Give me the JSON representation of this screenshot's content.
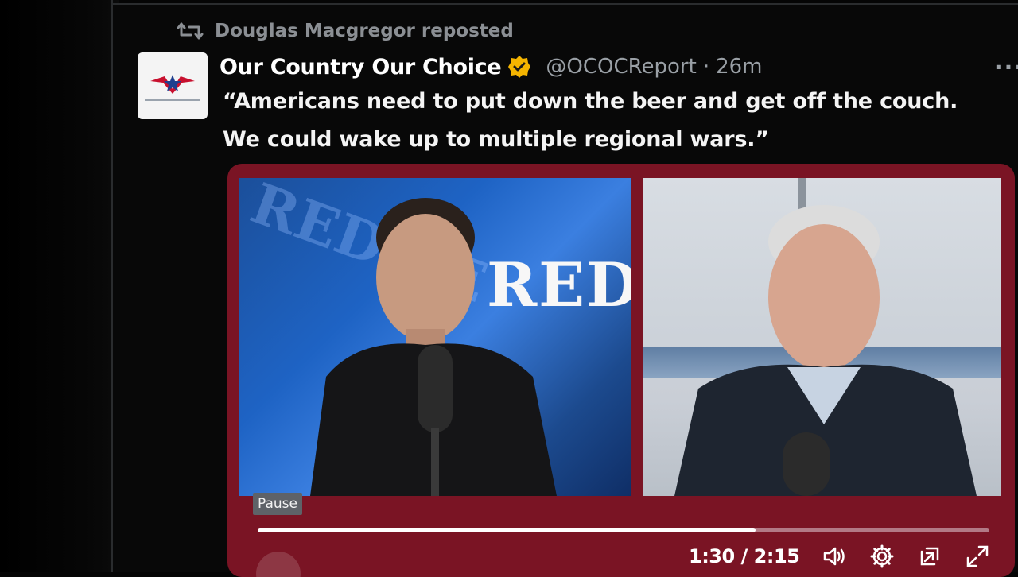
{
  "repost": {
    "icon": "repost-icon",
    "text": "Douglas Macgregor reposted"
  },
  "tweet": {
    "display_name": "Our Country Our Choice",
    "verified_icon": "verified-badge-icon",
    "verified_color": "#f4b400",
    "handle": "@OCOCReport",
    "separator": "·",
    "time": "26m",
    "more_label": "···",
    "text": "“Americans need to put down the beer and get off the couch. We could wake up to multiple regional wars.”"
  },
  "video": {
    "overlay_text": "RED",
    "pause_tooltip": "Pause",
    "current_time": "1:30",
    "duration": "2:15",
    "time_display": "1:30 / 2:15",
    "progress_fraction": 0.68,
    "accent_color": "#7a1424",
    "controls": {
      "volume_icon": "volume-icon",
      "settings_icon": "gear-icon",
      "popout_icon": "popout-icon",
      "fullscreen_icon": "fullscreen-icon"
    }
  }
}
